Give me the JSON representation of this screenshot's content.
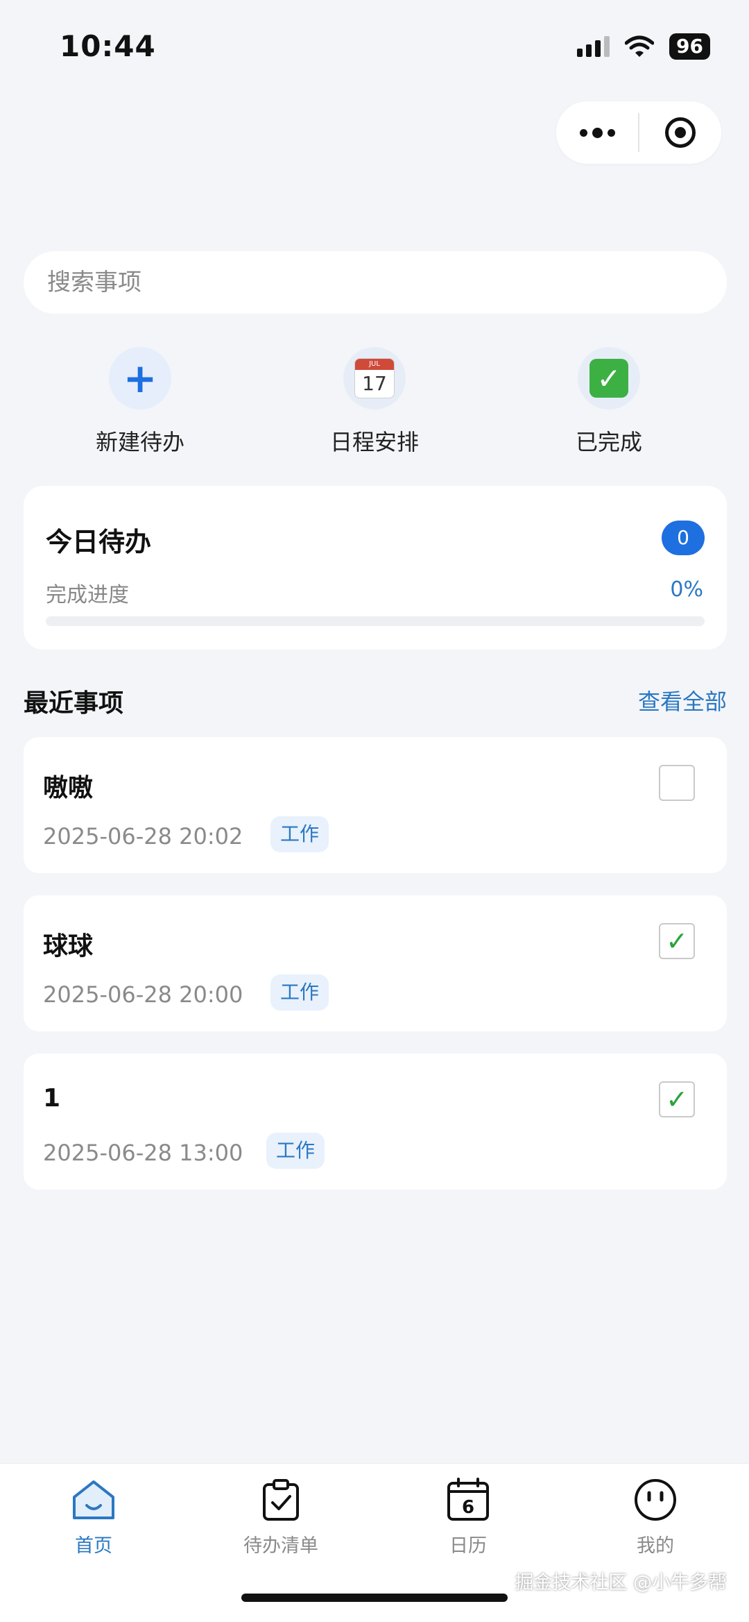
{
  "status_bar": {
    "time": "10:44",
    "battery": "96"
  },
  "search": {
    "placeholder": "搜索事项"
  },
  "actions": [
    {
      "label": "新建待办",
      "icon": "plus-icon"
    },
    {
      "label": "日程安排",
      "icon": "calendar-icon",
      "calendar_month": "JUL",
      "calendar_day": "17"
    },
    {
      "label": "已完成",
      "icon": "check-mark-icon"
    }
  ],
  "today": {
    "title": "今日待办",
    "count": "0",
    "progress_label": "完成进度",
    "progress_text": "0%",
    "progress_value": 0
  },
  "recent": {
    "title": "最近事项",
    "view_all": "查看全部",
    "items": [
      {
        "title": "嗷嗷",
        "time": "2025-06-28 20:02",
        "tag": "工作",
        "done": false
      },
      {
        "title": "球球",
        "time": "2025-06-28 20:00",
        "tag": "工作",
        "done": true
      },
      {
        "title": "1",
        "time": "2025-06-28 13:00",
        "tag": "工作",
        "done": true
      }
    ]
  },
  "tabs": [
    {
      "label": "首页",
      "icon": "home-icon",
      "active": true
    },
    {
      "label": "待办清单",
      "icon": "clipboard-check-icon",
      "active": false
    },
    {
      "label": "日历",
      "icon": "calendar-icon",
      "calendar_day": "6",
      "active": false
    },
    {
      "label": "我的",
      "icon": "smiley-icon",
      "active": false
    }
  ],
  "watermark": "掘金技术社区 @小牛多帮",
  "colors": {
    "accent": "#1e6fe0",
    "link": "#2b78c2",
    "check": "#2aa33a",
    "background": "#f3f5f9"
  }
}
